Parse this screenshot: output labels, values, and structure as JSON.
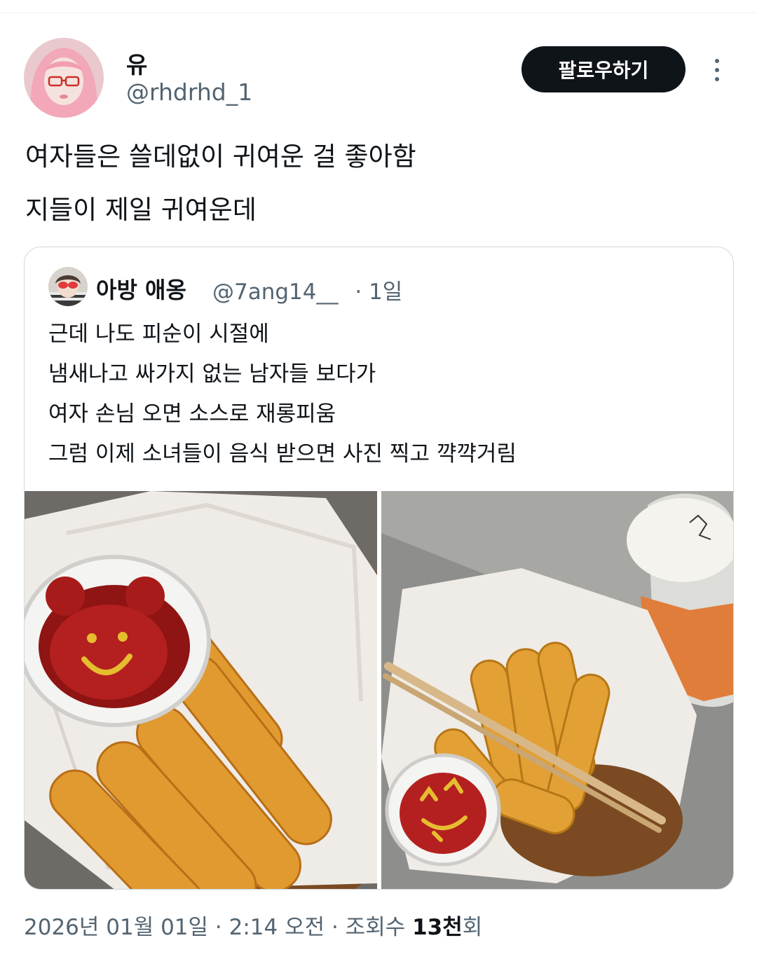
{
  "author": {
    "display_name": "유",
    "handle": "@rhdrhd_1",
    "avatar_icon": "profile-photo-pink-hair-glasses"
  },
  "follow_button_label": "팔로우하기",
  "tweet": {
    "lines": [
      "여자들은 쓸데없이 귀여운 걸 좋아함",
      "지들이 제일 귀여운데"
    ]
  },
  "quoted_tweet": {
    "display_name": "아방 애옹",
    "handle": "@7ang14__",
    "time": "· 1일",
    "avatar_icon": "profile-photo-red-sunglasses",
    "lines": [
      "근데 나도 피순이 시절에",
      "냄새나고 싸가지 없는 남자들 보다가",
      "여자 손님 오면 소스로 재롱피움",
      "그럼 이제 소녀들이 음식 받으면 사진 찍고 꺅꺅거림"
    ],
    "photos": [
      "photo-cheese-sticks-ketchup-bear-face",
      "photo-cheese-sticks-ketchup-cat-drink"
    ]
  },
  "meta": {
    "datetime": "2026년 01월 01일 · 2:14 오전 · 조회수 ",
    "views": "13천",
    "views_suffix": "회"
  },
  "colors": {
    "text": "#0f1419",
    "secondary": "#536471",
    "border": "#cfd9de",
    "button_bg": "#0f1419"
  }
}
